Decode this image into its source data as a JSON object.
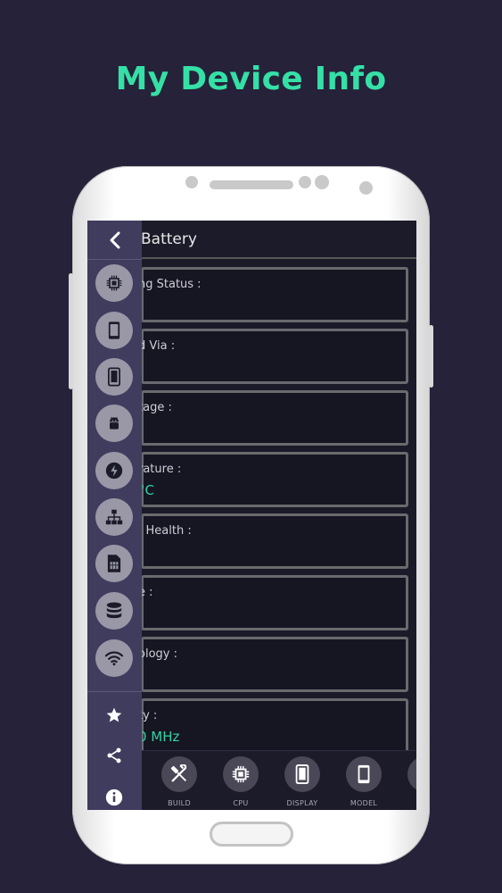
{
  "promo": {
    "title": "My Device Info"
  },
  "screen": {
    "header_title": "Battery",
    "cards": [
      {
        "label": "ng Status :",
        "value": ""
      },
      {
        "label": "d Via :",
        "value": ""
      },
      {
        "label": "tage :",
        "value": ""
      },
      {
        "label": "rature :",
        "value": "°C"
      },
      {
        "label": "/ Health :",
        "value": ""
      },
      {
        "label": "e :",
        "value": ""
      },
      {
        "label": "ology :",
        "value": ""
      },
      {
        "label": "ty :",
        "value": "0 MHz"
      }
    ],
    "bottom_nav": [
      {
        "label": "BUILD",
        "icon": "build-icon"
      },
      {
        "label": "CPU",
        "icon": "cpu-icon"
      },
      {
        "label": "DISPLAY",
        "icon": "display-icon"
      },
      {
        "label": "MODEL",
        "icon": "model-icon"
      }
    ]
  },
  "drawer": {
    "items": [
      "cpu-icon",
      "phone-icon",
      "display-icon",
      "android-icon",
      "battery-bolt-icon",
      "network-icon",
      "sim-card-icon",
      "storage-icon",
      "wifi-icon"
    ],
    "actions": [
      "star-icon",
      "share-icon",
      "info-icon"
    ]
  },
  "colors": {
    "background": "#25223a",
    "accent": "#35e0a6",
    "drawer": "#403c5e",
    "value_text": "#35d1a3"
  }
}
